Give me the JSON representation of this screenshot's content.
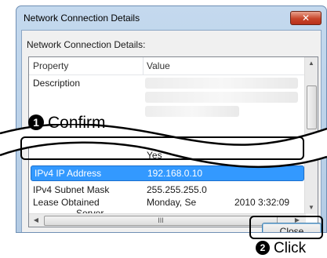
{
  "window": {
    "title": "Network Connection Details",
    "close_glyph": "✕"
  },
  "panel": {
    "label": "Network Connection Details:"
  },
  "table": {
    "columns": [
      "Property",
      "Value"
    ],
    "rows": [
      {
        "property": "Description",
        "value": ""
      },
      {
        "property": "",
        "value": "Yes"
      },
      {
        "property": "IPv4 IP Address",
        "value": "192.168.0.10"
      },
      {
        "property": "IPv4 Subnet Mask",
        "value": "255.255.255.0"
      },
      {
        "property": "Lease Obtained",
        "value": "Monday, Se"
      },
      {
        "property": "",
        "value": "2010 3:32:09"
      },
      {
        "property": "Server",
        "value": ""
      }
    ],
    "scroll_grip": "III"
  },
  "buttons": {
    "close": "Close"
  },
  "callouts": {
    "confirm": {
      "number": "1",
      "text": "Confirm"
    },
    "click": {
      "number": "2",
      "text": "Click"
    }
  },
  "icons": {
    "up_arrow": "▲",
    "down_arrow": "▼",
    "left_arrow": "◀",
    "right_arrow": "▶"
  }
}
